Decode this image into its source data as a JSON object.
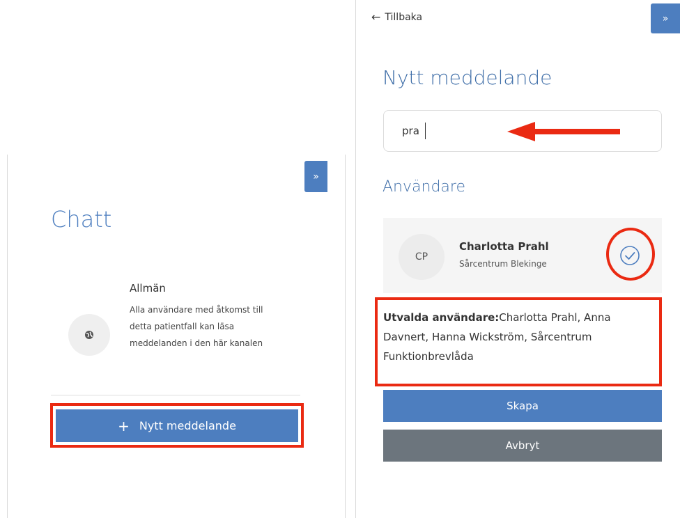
{
  "left_panel": {
    "expand_label": "»",
    "chat_title": "Chatt",
    "channel": {
      "name": "Allmän",
      "description": "Alla användare med åtkomst till detta patientfall kan läsa meddelanden i den här kanalen"
    },
    "new_message_plus": "+",
    "new_message_label": "Nytt meddelande"
  },
  "right_panel": {
    "expand_label": "»",
    "back_arrow": "←",
    "back_label": "Tillbaka",
    "title": "Nytt meddelande",
    "search_value": "pra",
    "users_heading": "Användare",
    "user": {
      "initials": "CP",
      "name": "Charlotta Prahl",
      "organization": "Sårcentrum Blekinge",
      "selected": true
    },
    "selected_label": "Utvalda användare:",
    "selected_users": "Charlotta Prahl, Anna Davnert, Hanna Wickström, Sårcentrum Funktionbrevlåda",
    "create_label": "Skapa",
    "cancel_label": "Avbryt"
  },
  "colors": {
    "primary": "#4d7ebf",
    "title_blue": "#3f6ea8",
    "secondary": "#6c757d",
    "annotation_red": "#ea2a12"
  },
  "icons": [
    "globe-icon",
    "check-circle-icon",
    "arrow-left-icon",
    "double-chevron-right-icon",
    "plus-icon"
  ]
}
